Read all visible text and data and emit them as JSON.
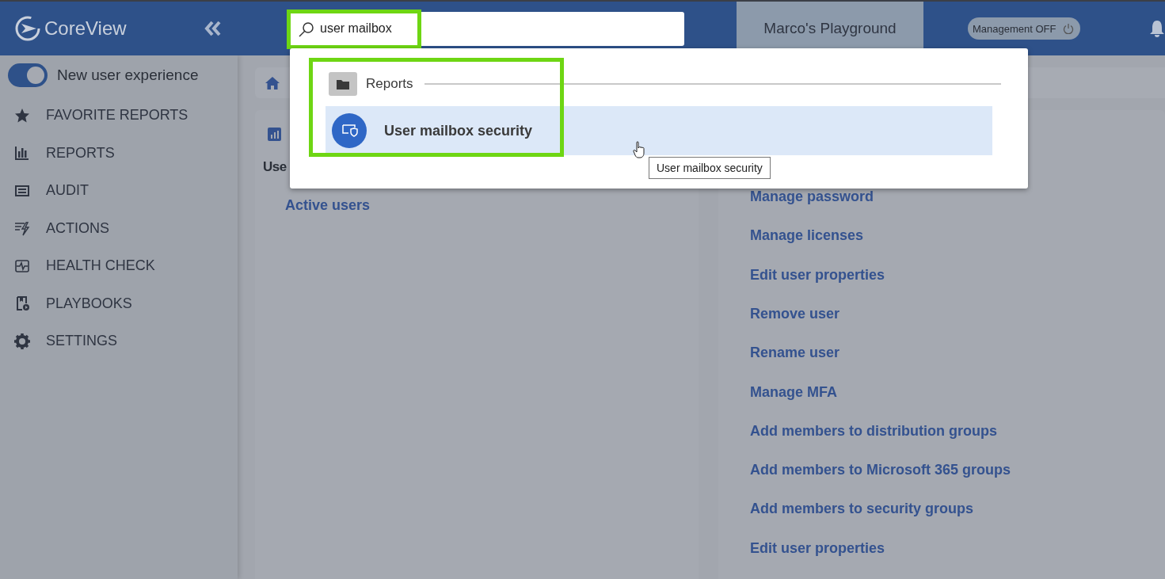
{
  "header": {
    "logo": "CoreView",
    "search": {
      "value": "user mailbox"
    },
    "tenant": "Marco's Playground",
    "management": {
      "label": "Management OFF",
      "on": false
    }
  },
  "sidebar": {
    "toggle": {
      "label": "New user experience",
      "on": true
    },
    "items": [
      {
        "label": "FAVORITE REPORTS",
        "kind": "star"
      },
      {
        "label": "REPORTS",
        "kind": "chart"
      },
      {
        "label": "AUDIT",
        "kind": "list"
      },
      {
        "label": "ACTIONS",
        "kind": "bolt"
      },
      {
        "label": "HEALTH CHECK",
        "kind": "pulse"
      },
      {
        "label": "PLAYBOOKS",
        "kind": "book"
      },
      {
        "label": "SETTINGS",
        "kind": "gear"
      }
    ]
  },
  "left_card": {
    "title": "Use",
    "links": [
      "Active users"
    ]
  },
  "right_card": {
    "links": [
      "Manage password",
      "Manage licenses",
      "Edit user properties",
      "Remove user",
      "Rename user",
      "Manage MFA",
      "Add members to distribution groups",
      "Add members to Microsoft 365 groups",
      "Add members to security groups",
      "Edit user properties"
    ]
  },
  "search_dropdown": {
    "category": "Reports",
    "results": [
      {
        "label": "User mailbox security",
        "selected": true
      }
    ],
    "tooltip": "User mailbox security"
  }
}
